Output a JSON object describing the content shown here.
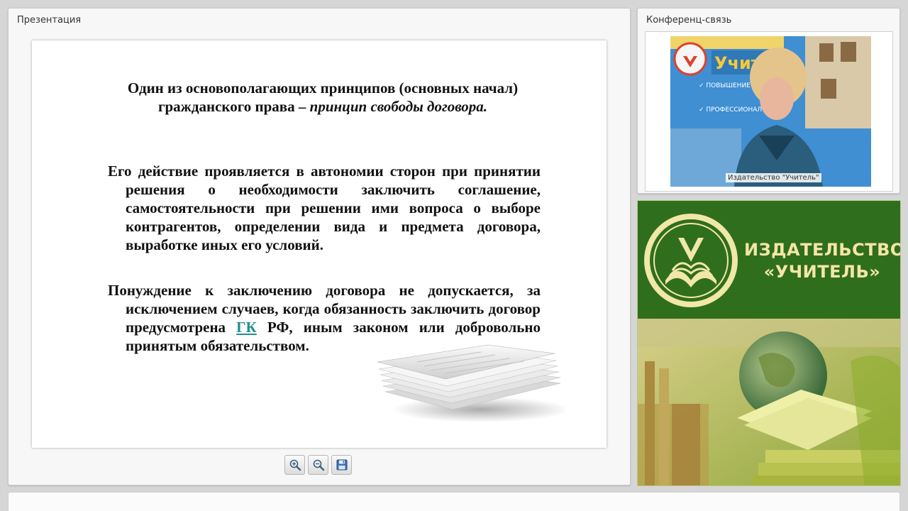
{
  "presentation": {
    "title": "Презентация",
    "slide": {
      "heading_normal": "Один из основополагающих принципов (основных начал) гражданского права – ",
      "heading_italic": "принцип свободы договора.",
      "para1": "Его действие проявляется в автономии сторон при принятии решения о необходимости заключить соглашение, самостоятельности при решении ими вопроса о выборе контрагентов, определении вида и предмета договора, выработке иных его условий.",
      "para2_before": "Понуждение к заключению договора не допускается, за исключением случаев, когда обязанность заключить договор предусмотрена ",
      "para2_link": "ГК",
      "para2_after": " РФ, иным законом или добровольно принятым обязательством."
    },
    "toolbar": {
      "zoom_in_icon": "zoom-in-icon",
      "zoom_out_icon": "zoom-out-icon",
      "save_icon": "save-icon"
    }
  },
  "conference": {
    "title": "Конференц-связь",
    "video_label": "Издательство \"Учитель\""
  },
  "promo": {
    "line1": "ИЗДАТЕЛЬСТВО",
    "line2": "«УЧИТЕЛЬ»"
  },
  "colors": {
    "link": "#1e8f8f",
    "promo_green": "#2f6e1c",
    "promo_text": "#f4e6a6"
  }
}
